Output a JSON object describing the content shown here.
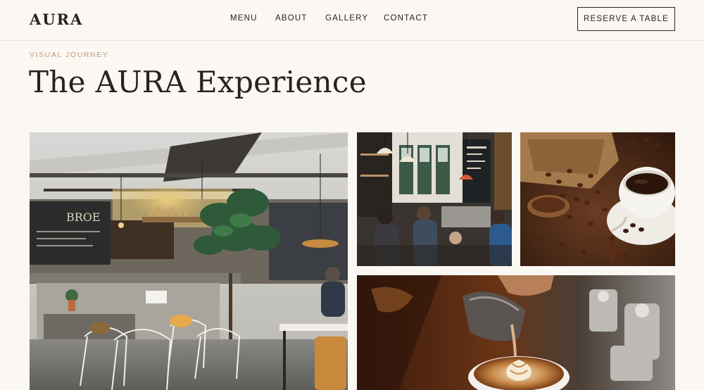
{
  "brand": {
    "logo": "AURA"
  },
  "nav": {
    "items": [
      "MENU",
      "ABOUT",
      "GALLERY",
      "CONTACT"
    ],
    "cta_label": "RESERVE A TABLE"
  },
  "hero": {
    "eyebrow": "VISUAL JOURNEY",
    "title": "The AURA Experience"
  },
  "gallery": {
    "images": [
      {
        "subject": "cafe interior with plants and seating"
      },
      {
        "subject": "busy coffee bar with pendant lamps"
      },
      {
        "subject": "coffee beans and cup of coffee"
      },
      {
        "subject": "latte art being poured"
      }
    ]
  },
  "colors": {
    "background": "#fbf7f3",
    "text": "#2a211c",
    "accent": "#c29a72",
    "divider": "#ece4dc"
  }
}
